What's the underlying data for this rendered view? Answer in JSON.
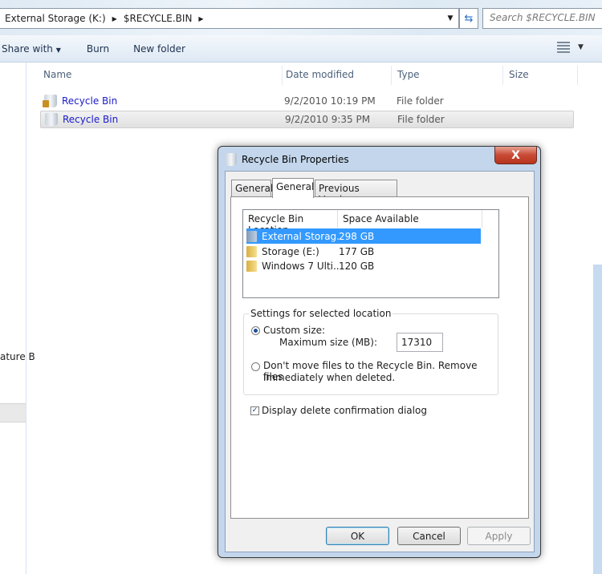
{
  "address": {
    "crumbs": [
      "External Storage (K:)",
      "$RECYCLE.BIN"
    ],
    "search_placeholder": "Search $RECYCLE.BIN"
  },
  "toolbar": {
    "share": "Share with",
    "burn": "Burn",
    "new_folder": "New folder"
  },
  "nav": {
    "partial_item": "ature B"
  },
  "columns": [
    "Name",
    "Date modified",
    "Type",
    "Size"
  ],
  "files": [
    {
      "name": "Recycle Bin",
      "date": "9/2/2010 10:19 PM",
      "type": "File folder",
      "locked": true
    },
    {
      "name": "Recycle Bin",
      "date": "9/2/2010 9:35 PM",
      "type": "File folder",
      "selected": true
    }
  ],
  "dialog": {
    "title": "Recycle Bin Properties",
    "close": "X",
    "tabs": [
      "General",
      "General",
      "Previous Versions"
    ],
    "active_tab": 1,
    "list_headers": [
      "Recycle Bin Location",
      "Space Available"
    ],
    "locations": [
      {
        "name": "External Storag...",
        "space": "298 GB",
        "selected": true
      },
      {
        "name": "Storage (E:)",
        "space": "177 GB"
      },
      {
        "name": "Windows 7 Ulti...",
        "space": "120 GB"
      }
    ],
    "group_label": "Settings for selected location",
    "custom_size": "Custom size:",
    "max_size_label": "Maximum size (MB):",
    "max_size_value": "17310",
    "dont_move": "Don't move files to the Recycle Bin. Remove files",
    "dont_move_2": "immediately when deleted.",
    "confirm": "Display delete confirmation dialog",
    "confirm_checked": true,
    "ok": "OK",
    "cancel": "Cancel",
    "apply": "Apply"
  }
}
